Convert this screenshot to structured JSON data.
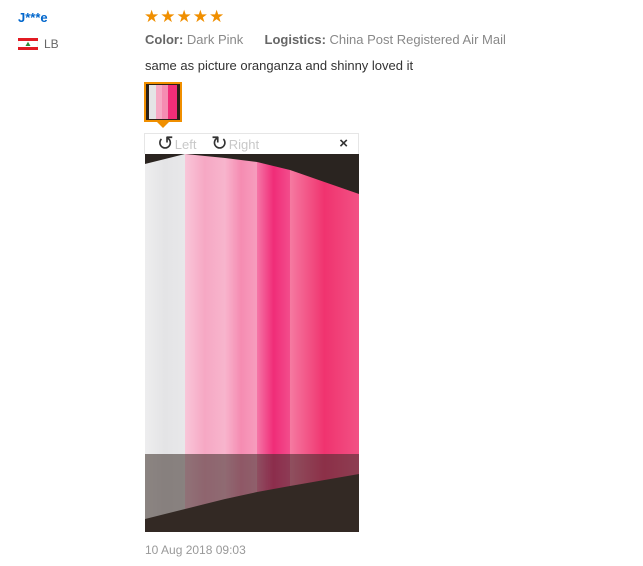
{
  "reviewer": {
    "name": "J***e",
    "country": "LB",
    "flag_colors": {
      "red": "#e21b23",
      "white": "#ffffff",
      "cedar": "#2e8b3a"
    }
  },
  "rating": {
    "value": 5,
    "max": 5,
    "star_color": "#f08f00"
  },
  "attributes": [
    {
      "key": "Color:",
      "value": "Dark Pink"
    },
    {
      "key": "Logistics:",
      "value": "China Post Registered Air Mail"
    }
  ],
  "review_text": "same as picture oranganza and shinny loved it",
  "photo_viewer": {
    "rotate_left_label": "Left",
    "rotate_right_label": "Right",
    "close_symbol": "×"
  },
  "date": "10 Aug 2018 09:03",
  "photo_colors": [
    "#e4e4e6",
    "#f6a8c4",
    "#f58cb2",
    "#f02d78",
    "#f0336f"
  ]
}
